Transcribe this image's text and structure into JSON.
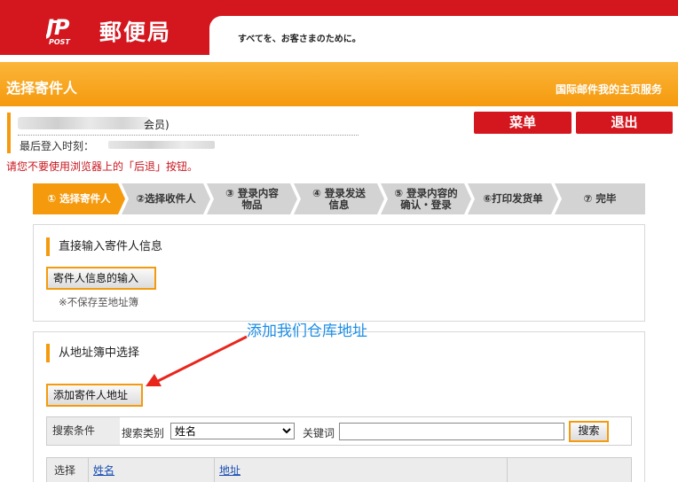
{
  "header": {
    "logo_text": "郵便局",
    "logo_sub": "POST",
    "slogan": "すべてを、お客さまのために。"
  },
  "orange_bar": {
    "title": "选择寄件人",
    "home_link": "国际邮件我的主页服务"
  },
  "user": {
    "member_type": "会员)",
    "last_login_label": "最后登入时刻："
  },
  "buttons": {
    "menu": "菜单",
    "logout": "退出"
  },
  "warning": "请您不要使用浏览器上的「后退」按钮。",
  "steps": [
    {
      "label": "① 选择寄件人"
    },
    {
      "label": "②选择收件人"
    },
    {
      "label": "③ 登录内容\n物品"
    },
    {
      "label": "④ 登录发送\n信息"
    },
    {
      "label": "⑤ 登录内容的\n确认・登录"
    },
    {
      "label": "⑥打印发货单"
    },
    {
      "label": "⑦ 完毕"
    }
  ],
  "direct_input": {
    "title": "直接输入寄件人信息",
    "button": "寄件人信息的输入",
    "note": "※不保存至地址簿"
  },
  "address_book": {
    "title": "从地址簿中选择",
    "add_button": "添加寄件人地址",
    "search": {
      "head": "搜索条件",
      "type_label": "搜索类别",
      "type_selected": "姓名",
      "keyword_label": "关键词",
      "keyword_value": "",
      "button": "搜索"
    },
    "columns": {
      "select": "选择",
      "name": "姓名",
      "address": "地址"
    }
  },
  "annotation": "添加我们仓库地址",
  "colors": {
    "brand_red": "#d4161e",
    "orange": "#f59a0d",
    "annotation_blue": "#1e8ee6"
  }
}
